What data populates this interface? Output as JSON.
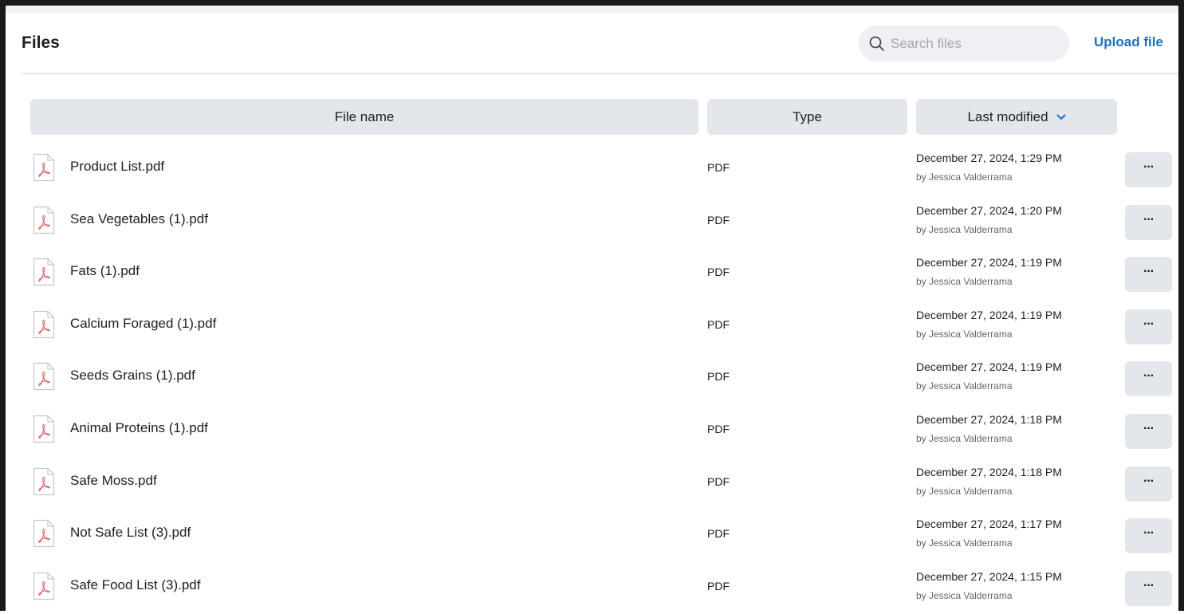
{
  "header": {
    "title": "Files",
    "search_placeholder": "Search files",
    "upload_label": "Upload file"
  },
  "table": {
    "columns": {
      "name": "File name",
      "type": "Type",
      "modified": "Last modified"
    },
    "sort_icon": "chevron-down-icon",
    "rows": [
      {
        "name": "Product List.pdf",
        "type": "PDF",
        "date": "December 27, 2024, 1:29 PM",
        "by": "by Jessica Valderrama",
        "more": "···"
      },
      {
        "name": "Sea Vegetables (1).pdf",
        "type": "PDF",
        "date": "December 27, 2024, 1:20 PM",
        "by": "by Jessica Valderrama",
        "more": "···"
      },
      {
        "name": "Fats (1).pdf",
        "type": "PDF",
        "date": "December 27, 2024, 1:19 PM",
        "by": "by Jessica Valderrama",
        "more": "···"
      },
      {
        "name": "Calcium Foraged (1).pdf",
        "type": "PDF",
        "date": "December 27, 2024, 1:19 PM",
        "by": "by Jessica Valderrama",
        "more": "···"
      },
      {
        "name": "Seeds Grains (1).pdf",
        "type": "PDF",
        "date": "December 27, 2024, 1:19 PM",
        "by": "by Jessica Valderrama",
        "more": "···"
      },
      {
        "name": "Animal Proteins (1).pdf",
        "type": "PDF",
        "date": "December 27, 2024, 1:18 PM",
        "by": "by Jessica Valderrama",
        "more": "···"
      },
      {
        "name": "Safe Moss.pdf",
        "type": "PDF",
        "date": "December 27, 2024, 1:18 PM",
        "by": "by Jessica Valderrama",
        "more": "···"
      },
      {
        "name": "Not Safe List (3).pdf",
        "type": "PDF",
        "date": "December 27, 2024, 1:17 PM",
        "by": "by Jessica Valderrama",
        "more": "···"
      },
      {
        "name": "Safe Food List (3).pdf",
        "type": "PDF",
        "date": "December 27, 2024, 1:15 PM",
        "by": "by Jessica Valderrama",
        "more": "···"
      }
    ]
  },
  "colors": {
    "accent": "#1b6fbb",
    "pdf_icon": "#e0606b",
    "header_bg": "#e3e6ea"
  }
}
